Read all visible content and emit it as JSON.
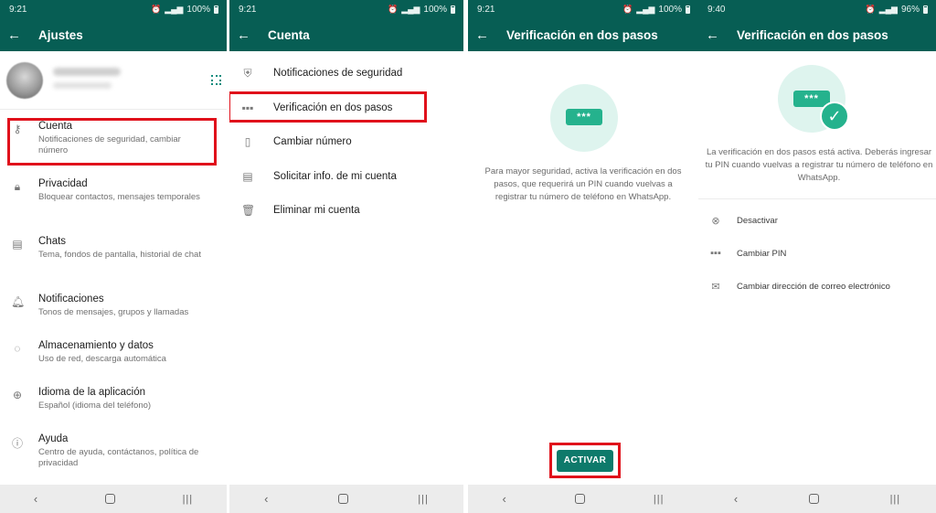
{
  "panels": [
    {
      "status": {
        "time": "9:21",
        "battery": "100%"
      },
      "appbar": {
        "title": "Ajustes"
      },
      "items": [
        {
          "title": "Cuenta",
          "subtitle": "Notificaciones de seguridad, cambiar número",
          "icon": "key-icon"
        },
        {
          "title": "Privacidad",
          "subtitle": "Bloquear contactos, mensajes temporales",
          "icon": "lock-icon"
        },
        {
          "title": "Chats",
          "subtitle": "Tema, fondos de pantalla, historial de chat",
          "icon": "chat-icon"
        },
        {
          "title": "Notificaciones",
          "subtitle": "Tonos de mensajes, grupos y llamadas",
          "icon": "bell-icon"
        },
        {
          "title": "Almacenamiento y datos",
          "subtitle": "Uso de red, descarga automática",
          "icon": "storage-icon"
        },
        {
          "title": "Idioma de la aplicación",
          "subtitle": "Español (idioma del teléfono)",
          "icon": "globe-icon"
        },
        {
          "title": "Ayuda",
          "subtitle": "Centro de ayuda, contáctanos, política de privacidad",
          "icon": "help-icon"
        }
      ]
    },
    {
      "status": {
        "time": "9:21",
        "battery": "100%"
      },
      "appbar": {
        "title": "Cuenta"
      },
      "items": [
        {
          "label": "Notificaciones de seguridad",
          "icon": "shield-icon"
        },
        {
          "label": "Verificación en dos pasos",
          "icon": "pin-dots-icon"
        },
        {
          "label": "Cambiar número",
          "icon": "phone-swap-icon"
        },
        {
          "label": "Solicitar info. de mi cuenta",
          "icon": "document-icon"
        },
        {
          "label": "Eliminar mi cuenta",
          "icon": "trash-icon"
        }
      ]
    },
    {
      "status": {
        "time": "9:21",
        "battery": "100%"
      },
      "appbar": {
        "title": "Verificación en dos pasos"
      },
      "pin_glyph": "***",
      "description": "Para mayor seguridad, activa la verificación en dos pasos, que requerirá un PIN cuando vuelvas a registrar tu número de teléfono en WhatsApp.",
      "button": "ACTIVAR"
    },
    {
      "status": {
        "time": "9:40",
        "battery": "96%"
      },
      "appbar": {
        "title": "Verificación en dos pasos"
      },
      "pin_glyph": "***",
      "description": "La verificación en dos pasos está activa. Deberás ingresar tu PIN cuando vuelvas a registrar tu número de teléfono en WhatsApp.",
      "items": [
        {
          "label": "Desactivar",
          "icon": "cancel-circle-icon"
        },
        {
          "label": "Cambiar PIN",
          "icon": "pin-dots-icon"
        },
        {
          "label": "Cambiar dirección de correo electrónico",
          "icon": "mail-icon"
        }
      ]
    }
  ],
  "colors": {
    "appbar": "#075e54",
    "accent": "#25b28d",
    "button": "#0e7a6b",
    "highlight": "#e0111b"
  }
}
